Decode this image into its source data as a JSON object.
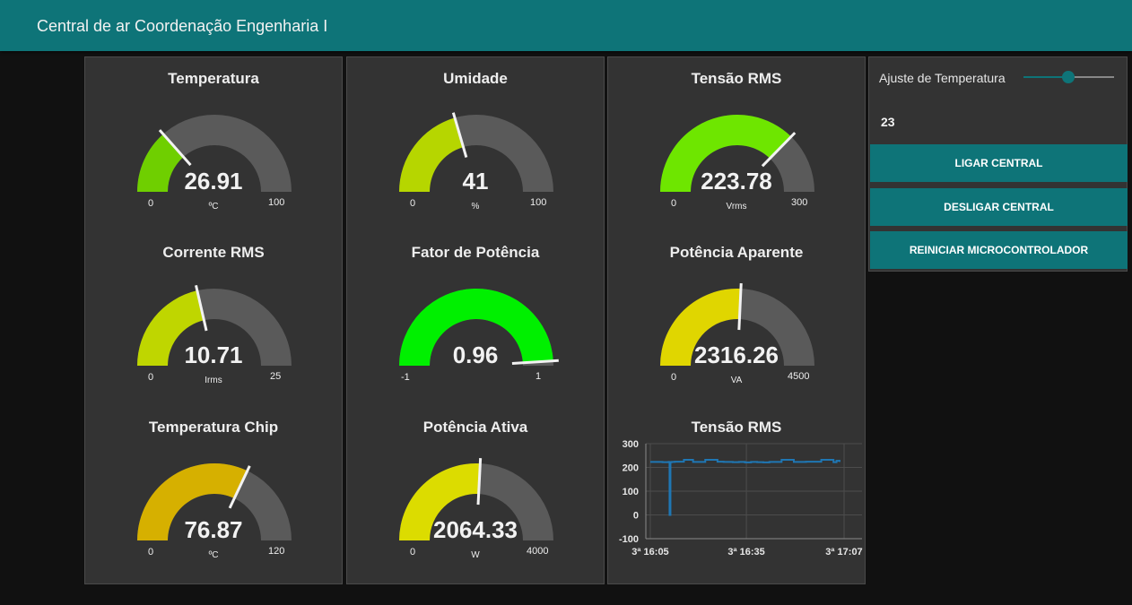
{
  "header": {
    "title": "Central de ar Coordenação Engenharia I"
  },
  "gauges": [
    {
      "id": "temperatura",
      "title": "Temperatura",
      "value": "26.91",
      "numeric": 26.91,
      "min": "0",
      "max": "100",
      "unit": "ºC",
      "color": "#6fcf00"
    },
    {
      "id": "umidade",
      "title": "Umidade",
      "value": "41",
      "numeric": 41,
      "min": "0",
      "max": "100",
      "unit": "%",
      "color": "#b6d600"
    },
    {
      "id": "tensao",
      "title": "Tensão RMS",
      "value": "223.78",
      "numeric": 223.78,
      "min": "0",
      "max": "300",
      "unit": "Vrms",
      "color": "#6ee600"
    },
    {
      "id": "corrente",
      "title": "Corrente RMS",
      "value": "10.71",
      "numeric": 10.71,
      "min": "0",
      "max": "25",
      "unit": "Irms",
      "color": "#bfd600"
    },
    {
      "id": "fator",
      "title": "Fator de Potência",
      "value": "0.96",
      "numeric": 0.96,
      "min": "-1",
      "max": "1",
      "unit": "",
      "color": "#00f000"
    },
    {
      "id": "aparente",
      "title": "Potência Aparente",
      "value": "2316.26",
      "numeric": 2316.26,
      "min": "0",
      "max": "4500",
      "unit": "VA",
      "color": "#e0d600"
    },
    {
      "id": "chip",
      "title": "Temperatura Chip",
      "value": "76.87",
      "numeric": 76.87,
      "min": "0",
      "max": "120",
      "unit": "ºC",
      "color": "#d6b000"
    },
    {
      "id": "ativa",
      "title": "Potência Ativa",
      "value": "2064.33",
      "numeric": 2064.33,
      "min": "0",
      "max": "4000",
      "unit": "W",
      "color": "#dcdc00"
    }
  ],
  "gauge_colors": {
    "background": "#5a5a5a",
    "needle": "#f2f2f2"
  },
  "controls": {
    "slider_label": "Ajuste de Temperatura",
    "slider_value": "23",
    "slider_fraction": 0.5,
    "buttons": [
      "LIGAR CENTRAL",
      "DESLIGAR CENTRAL",
      "REINICIAR MICROCONTROLADOR"
    ],
    "accent": "#0e7478"
  },
  "chart_title": "Tensão RMS",
  "chart_data": {
    "type": "line",
    "title": "Tensão RMS",
    "xlabel": "",
    "ylabel": "",
    "ylim": [
      -100,
      300
    ],
    "yticks": [
      "300",
      "200",
      "100",
      "0",
      "-100"
    ],
    "xticks": [
      "3ª 16:05",
      "3ª 16:35",
      "3ª 17:07"
    ],
    "grid": true,
    "line_color": "#1f77b4",
    "series": [
      {
        "x_minutes": [
          0,
          4,
          6,
          6.3,
          6.6,
          7,
          8,
          10,
          11,
          12,
          14,
          17,
          18,
          20,
          22,
          24,
          27,
          29,
          31,
          33,
          35,
          37,
          39,
          41,
          43,
          45,
          47,
          49,
          51,
          54,
          56,
          58,
          60,
          61,
          62
        ],
        "values": [
          223,
          222,
          223,
          0,
          222,
          223,
          224,
          224,
          232,
          232,
          223,
          223,
          232,
          232,
          224,
          223,
          222,
          223,
          221,
          223,
          222,
          221,
          223,
          223,
          232,
          232,
          223,
          223,
          224,
          224,
          232,
          232,
          222,
          228,
          223
        ]
      }
    ]
  }
}
